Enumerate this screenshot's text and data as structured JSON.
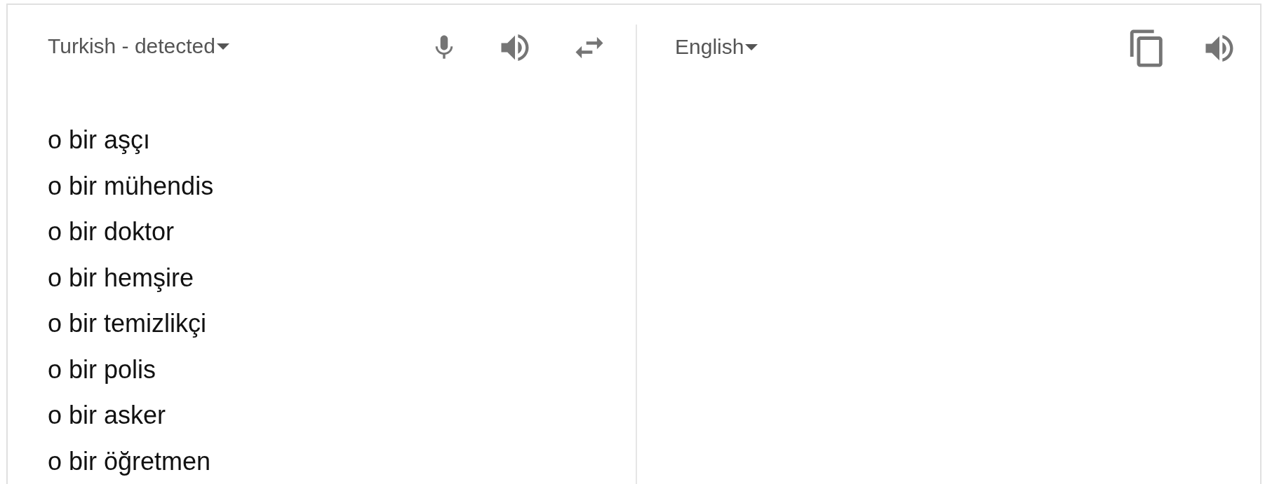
{
  "source_pane": {
    "language": "Turkish - detected",
    "lines": [
      "o bir aşçı",
      "o bir mühendis",
      "o bir doktor",
      "o bir hemşire",
      "o bir temizlikçi",
      "o bir polis",
      "o bir asker",
      "o bir öğretmen"
    ]
  },
  "target_pane": {
    "language": "English"
  }
}
